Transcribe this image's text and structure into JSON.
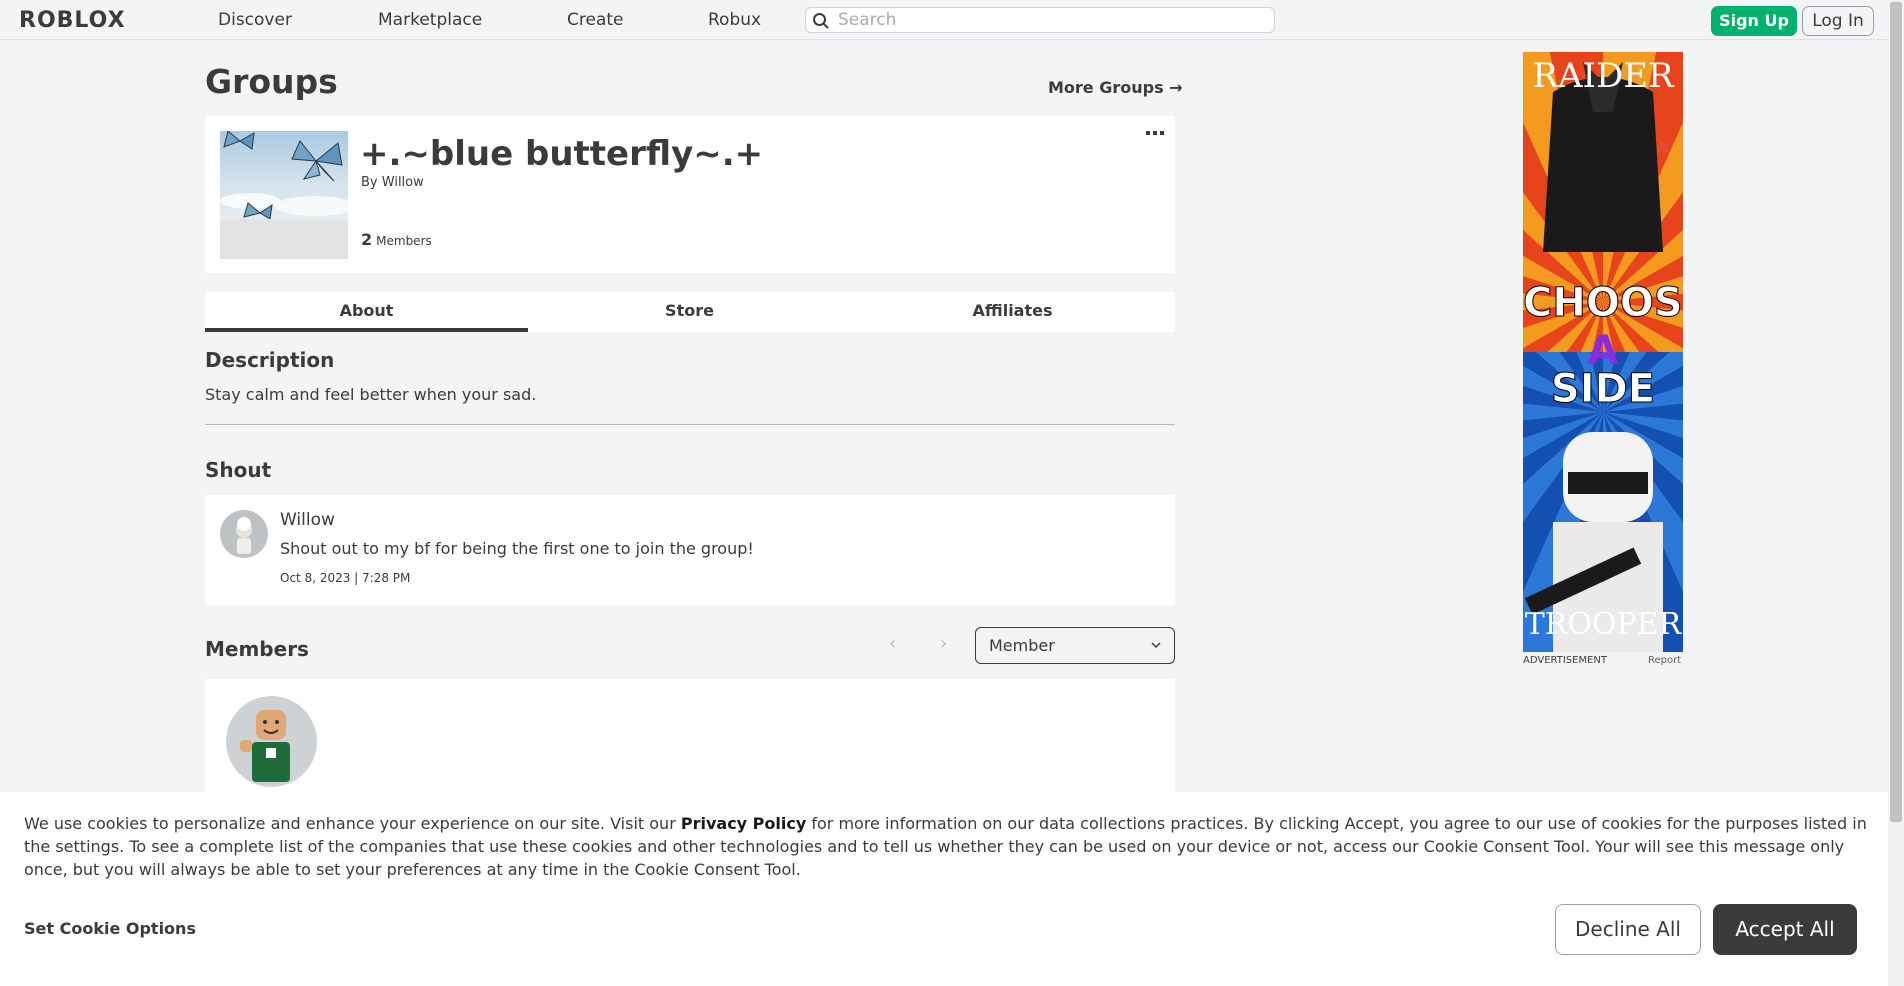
{
  "nav": {
    "logo": "ROBLOX",
    "links": [
      "Discover",
      "Marketplace",
      "Create",
      "Robux"
    ],
    "search_placeholder": "Search",
    "signup": "Sign Up",
    "login": "Log In"
  },
  "page": {
    "title": "Groups",
    "more_groups": "More Groups →"
  },
  "group": {
    "name": "+.~blue butterfly~.+",
    "by_prefix": "By",
    "owner": "Willow",
    "member_count": "2",
    "members_label": "Members"
  },
  "tabs": [
    "About",
    "Store",
    "Affiliates"
  ],
  "about": {
    "description_heading": "Description",
    "description": "Stay calm and feel better when your sad.",
    "shout_heading": "Shout",
    "shout": {
      "author": "Willow",
      "message": "Shout out to my bf for being the first one to join the group!",
      "date": "Oct 8, 2023 | 7:28 PM"
    },
    "members_heading": "Members",
    "role_filter": "Member"
  },
  "ad": {
    "word_top": "RAIDER",
    "line1": "CHOOSE",
    "line2": "A",
    "line3": "SIDE",
    "word_bottom": "TROOPER",
    "label": "ADVERTISEMENT",
    "report": "Report"
  },
  "cookie": {
    "text_before": "We use cookies to personalize and enhance your experience on our site. Visit our ",
    "privacy_link": "Privacy Policy",
    "text_after": " for more information on our data collections practices. By clicking Accept, you agree to our use of cookies for the purposes listed in the settings. To see a complete list of the companies that use these cookies and other technologies and to tell us whether they can be used on your device or not, access our Cookie Consent Tool. Your will see this message only once, but you will always be able to set your preferences at any time in the Cookie Consent Tool.",
    "set_options": "Set Cookie Options",
    "decline": "Decline All",
    "accept": "Accept All"
  }
}
